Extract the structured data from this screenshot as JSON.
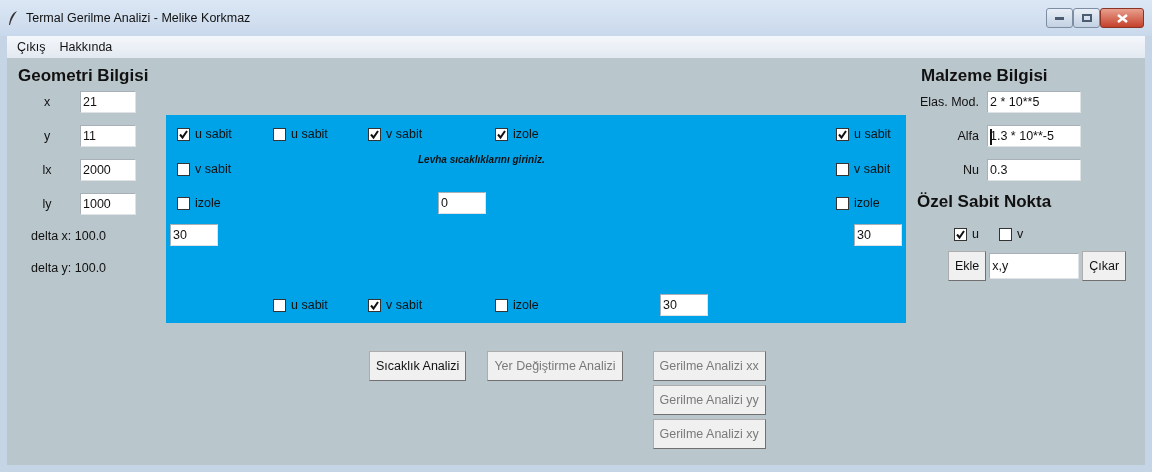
{
  "window": {
    "title": "Termal Gerilme Analizi - Melike Korkmaz"
  },
  "menu": [
    "Çıkış",
    "Hakkında"
  ],
  "geometry": {
    "title": "Geometri Bilgisi",
    "fields": [
      {
        "label": "x",
        "value": "21"
      },
      {
        "label": "y",
        "value": "11"
      },
      {
        "label": "lx",
        "value": "2000"
      },
      {
        "label": "ly",
        "value": "1000"
      }
    ],
    "deltas": [
      "delta x: 100.0",
      "delta y: 100.0"
    ]
  },
  "plate": {
    "instruction": "Levha sıcaklıklarını giriniz.",
    "left_edge": {
      "checkboxes": [
        {
          "label": "u sabit",
          "checked": true
        },
        {
          "label": "v sabit",
          "checked": false
        },
        {
          "label": "izole",
          "checked": false
        }
      ],
      "temperature": "30"
    },
    "top_edge": {
      "checkboxes": [
        {
          "label": "u sabit",
          "checked": false
        },
        {
          "label": "v sabit",
          "checked": true
        },
        {
          "label": "izole",
          "checked": true
        }
      ],
      "temperature": "0"
    },
    "right_edge": {
      "checkboxes": [
        {
          "label": "u sabit",
          "checked": true
        },
        {
          "label": "v sabit",
          "checked": false
        },
        {
          "label": "izole",
          "checked": false
        }
      ],
      "temperature": "30"
    },
    "bottom_edge": {
      "checkboxes": [
        {
          "label": "u sabit",
          "checked": false
        },
        {
          "label": "v sabit",
          "checked": true
        },
        {
          "label": "izole",
          "checked": false
        }
      ],
      "temperature": "30"
    }
  },
  "material": {
    "title": "Malzeme Bilgisi",
    "fields": [
      {
        "label": "Elas. Mod.",
        "value": "2 * 10**5",
        "focused": false
      },
      {
        "label": "Alfa",
        "value": "1.3 * 10**-5",
        "focused": true
      },
      {
        "label": "Nu",
        "value": "0.3",
        "focused": false
      }
    ]
  },
  "fixed_point": {
    "title": "Özel Sabit Nokta",
    "checkboxes": [
      {
        "label": "u",
        "checked": true
      },
      {
        "label": "v",
        "checked": false
      }
    ],
    "add_button": "Ekle",
    "point_value": "x,y",
    "remove_button": "Çıkar"
  },
  "analysis_buttons": [
    {
      "label": "Sıcaklık Analizi",
      "disabled": false
    },
    {
      "label": "Yer Değiştirme Analizi",
      "disabled": true
    }
  ],
  "stress_buttons": [
    {
      "label": "Gerilme Analizi xx",
      "disabled": true
    },
    {
      "label": "Gerilme Analizi yy",
      "disabled": true
    },
    {
      "label": "Gerilme Analizi xy",
      "disabled": true
    }
  ]
}
